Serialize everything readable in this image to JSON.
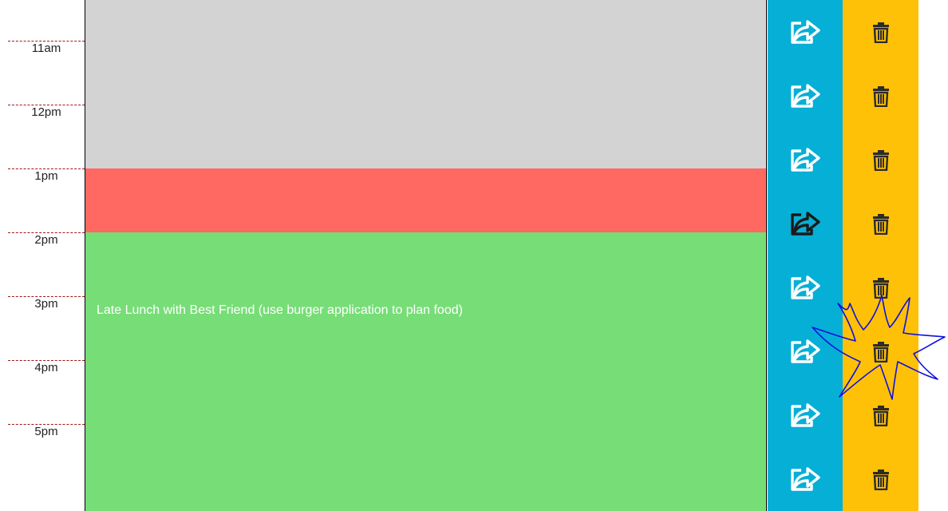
{
  "time_slots": [
    {
      "hour_label": "11am",
      "state": "past"
    },
    {
      "hour_label": "12pm",
      "state": "past"
    },
    {
      "hour_label": "1pm",
      "state": "present"
    },
    {
      "hour_label": "2pm",
      "state": "future"
    },
    {
      "hour_label": "3pm",
      "state": "future"
    },
    {
      "hour_label": "4pm",
      "state": "future"
    },
    {
      "hour_label": "5pm",
      "state": "future"
    }
  ],
  "event": {
    "text": "Late Lunch with Best Friend (use burger application to plan food)"
  },
  "icons": {
    "save": "share-icon",
    "delete": "trash-icon"
  },
  "colors": {
    "past": "#d3d3d3",
    "present": "#ff6961",
    "future": "#77dd77",
    "save_column": "#06afd6",
    "delete_column": "#ffc107",
    "hour_divider": "#a01818",
    "scribble": "#1010e0"
  }
}
